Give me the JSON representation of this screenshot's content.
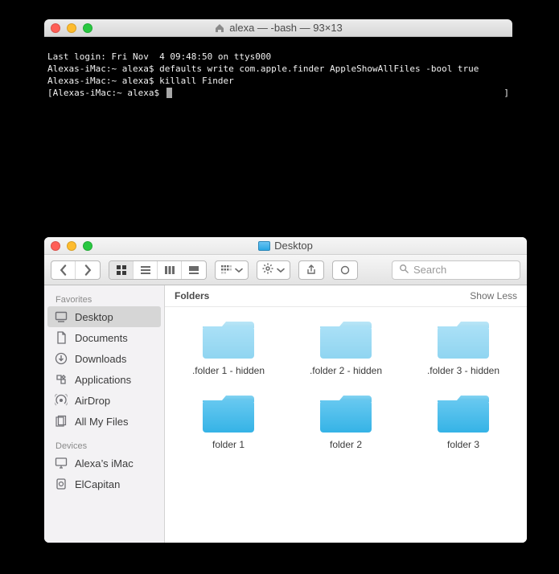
{
  "terminal": {
    "title": "alexa — -bash — 93×13",
    "lines": [
      "Last login: Fri Nov  4 09:48:50 on ttys000",
      "Alexas-iMac:~ alexa$ defaults write com.apple.finder AppleShowAllFiles -bool true",
      "Alexas-iMac:~ alexa$ killall Finder"
    ],
    "prompt_open": "[",
    "prompt": "Alexas-iMac:~ alexa$",
    "prompt_close": "]"
  },
  "finder": {
    "title": "Desktop",
    "search_placeholder": "Search",
    "sidebar": {
      "favorites_label": "Favorites",
      "devices_label": "Devices",
      "favorites": [
        {
          "label": "Desktop",
          "icon": "desktop-icon",
          "selected": true
        },
        {
          "label": "Documents",
          "icon": "documents-icon",
          "selected": false
        },
        {
          "label": "Downloads",
          "icon": "downloads-icon",
          "selected": false
        },
        {
          "label": "Applications",
          "icon": "applications-icon",
          "selected": false
        },
        {
          "label": "AirDrop",
          "icon": "airdrop-icon",
          "selected": false
        },
        {
          "label": "All My Files",
          "icon": "allfiles-icon",
          "selected": false
        }
      ],
      "devices": [
        {
          "label": "Alexa’s iMac",
          "icon": "imac-icon"
        },
        {
          "label": "ElCapitan",
          "icon": "disk-icon"
        }
      ]
    },
    "section": {
      "title": "Folders",
      "toggle": "Show Less"
    },
    "items": [
      {
        "label": ".folder 1 - hidden",
        "hidden": true
      },
      {
        "label": ".folder 2 - hidden",
        "hidden": true
      },
      {
        "label": ".folder 3 - hidden",
        "hidden": true
      },
      {
        "label": "folder 1",
        "hidden": false
      },
      {
        "label": "folder 2",
        "hidden": false
      },
      {
        "label": "folder 3",
        "hidden": false
      }
    ]
  }
}
